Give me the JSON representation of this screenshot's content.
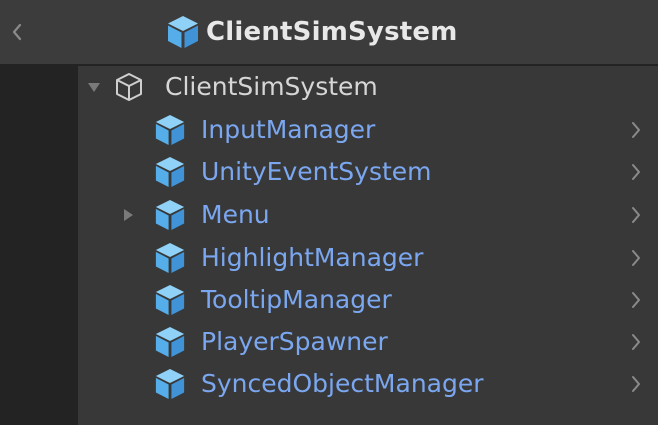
{
  "header": {
    "title": "ClientSimSystem",
    "back_icon": "chevron-left-icon",
    "title_icon": "prefab-cube-icon"
  },
  "tree": {
    "root": {
      "label": "ClientSimSystem",
      "expanded": true,
      "icon": "gameobject-cube-outline-icon"
    },
    "children": [
      {
        "label": "InputManager",
        "has_children": false
      },
      {
        "label": "UnityEventSystem",
        "has_children": false
      },
      {
        "label": "Menu",
        "has_children": true
      },
      {
        "label": "HighlightManager",
        "has_children": false
      },
      {
        "label": "TooltipManager",
        "has_children": false
      },
      {
        "label": "PlayerSpawner",
        "has_children": false
      },
      {
        "label": "SyncedObjectManager",
        "has_children": false
      }
    ]
  },
  "colors": {
    "background": "#282828",
    "header": "#3c3c3c",
    "tree_bg": "#383838",
    "prefab_text": "#7ba7f0",
    "prefab_icon": "#5eb4ee",
    "root_text": "#d6d6d6"
  }
}
